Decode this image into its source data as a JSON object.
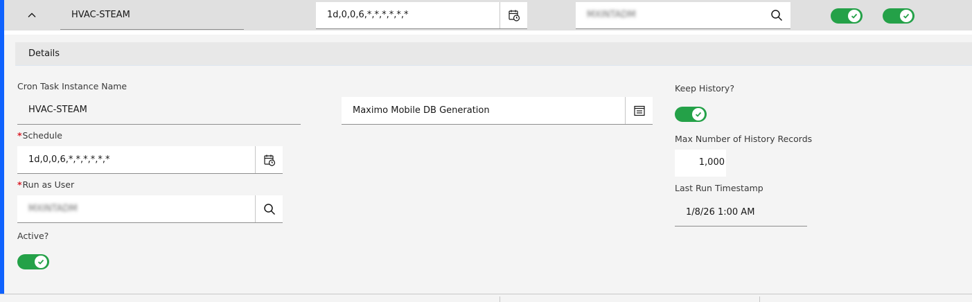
{
  "row": {
    "name": "HVAC-STEAM",
    "schedule": "1d,0,0,6,*,*,*,*,*,*",
    "run_as_user": "MXINTADM"
  },
  "details": {
    "header": "Details",
    "instance_name_label": "Cron Task Instance Name",
    "instance_name_value": "HVAC-STEAM",
    "description_value": "Maximo Mobile DB Generation",
    "schedule_label": "Schedule",
    "schedule_value": "1d,0,0,6,*,*,*,*,*,*",
    "run_as_user_label": "Run as User",
    "run_as_user_value": "MXINTADM",
    "active_label": "Active?",
    "keep_history_label": "Keep History?",
    "max_history_label": "Max Number of History Records",
    "max_history_value": "1,000",
    "last_run_label": "Last Run Timestamp",
    "last_run_value": "1/8/26 1:00 AM"
  },
  "required_marker": "*",
  "toggles": {
    "row_keep_history": true,
    "row_active": true,
    "keep_history": true,
    "active": true
  },
  "icons": {
    "collapse": "chevron-up-icon",
    "schedule": "calendar-clock-icon",
    "lookup": "search-icon",
    "detail_menu": "list-detail-icon",
    "toggle_check": "checkmark-icon"
  },
  "colors": {
    "accent": "#0f62fe",
    "toggle_on": "#24a148",
    "required": "#da1e28"
  }
}
